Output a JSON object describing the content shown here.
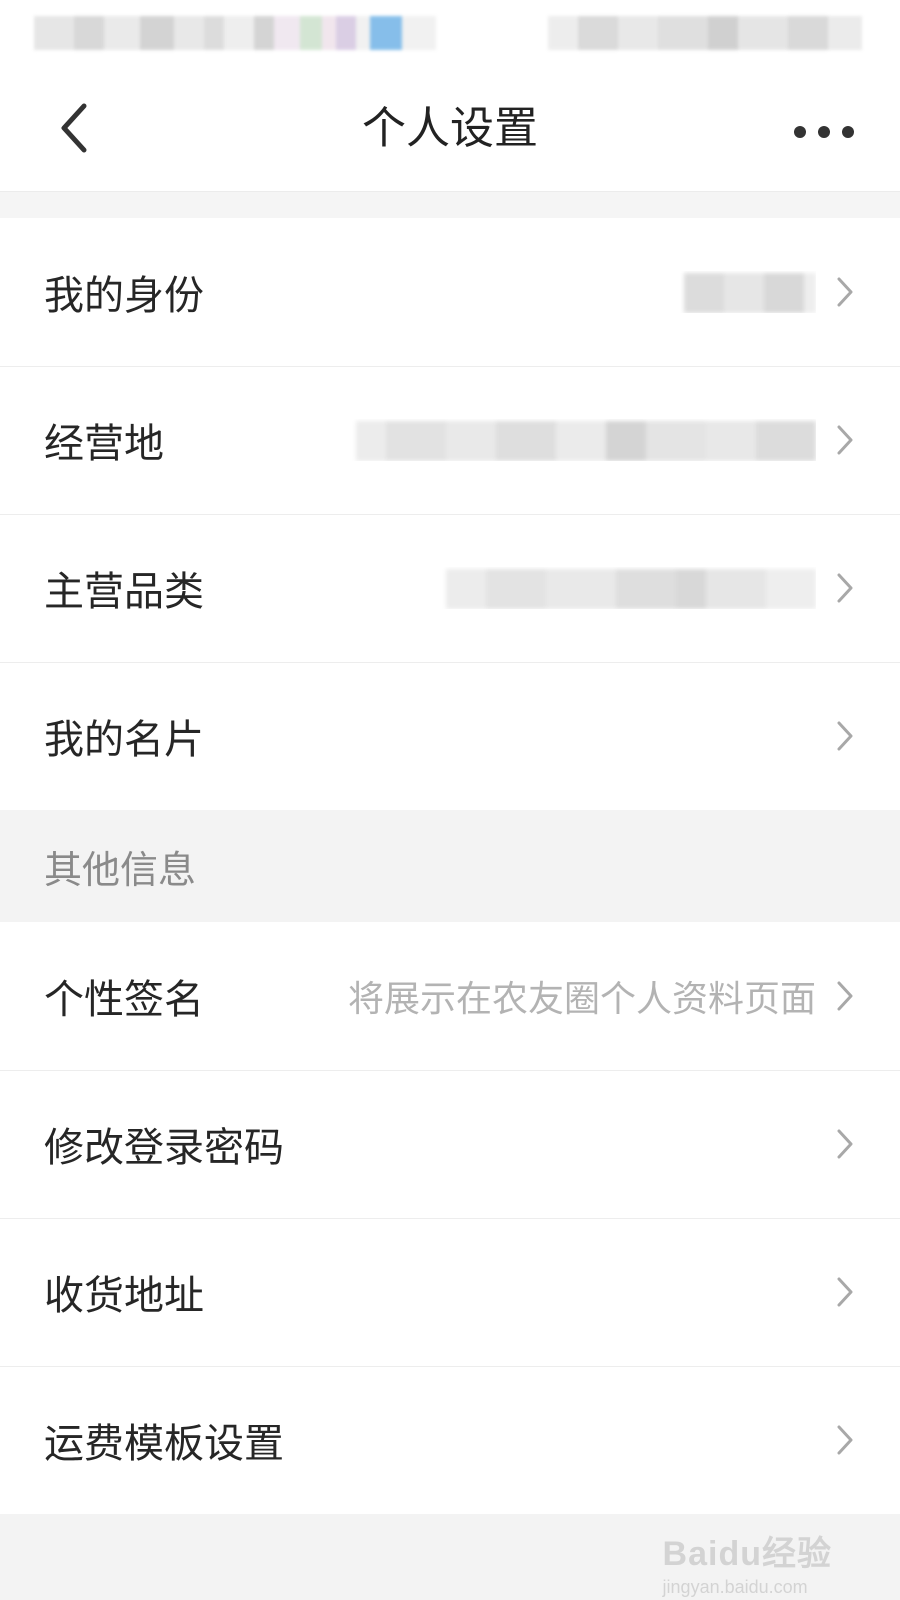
{
  "header": {
    "title": "个人设置",
    "back_icon": "chevron-left-icon",
    "more_icon": "more-horizontal-icon"
  },
  "group1": [
    {
      "label": "我的身份",
      "value": "",
      "value_redacted": true
    },
    {
      "label": "经营地",
      "value": "",
      "value_redacted": true
    },
    {
      "label": "主营品类",
      "value": "",
      "value_redacted": true
    },
    {
      "label": "我的名片",
      "value": ""
    }
  ],
  "section": {
    "title": "其他信息"
  },
  "group2": [
    {
      "label": "个性签名",
      "value": "将展示在农友圈个人资料页面"
    },
    {
      "label": "修改登录密码",
      "value": ""
    },
    {
      "label": "收货地址",
      "value": ""
    },
    {
      "label": "运费模板设置",
      "value": ""
    }
  ],
  "watermark": {
    "main": "Baidu经验",
    "url": "jingyan.baidu.com"
  },
  "colors": {
    "background": "#f5f5f5",
    "card": "#ffffff",
    "text": "#262626",
    "muted": "#b3b3b3",
    "section_text": "#8a8a8a"
  }
}
